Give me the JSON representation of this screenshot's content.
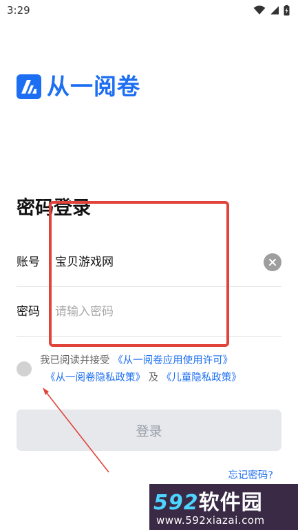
{
  "status_bar": {
    "time": "3:29"
  },
  "app": {
    "name": "从一阅卷"
  },
  "login": {
    "title": "密码登录",
    "account_label": "账号",
    "account_value": "宝贝游戏网",
    "password_label": "密码",
    "password_placeholder": "请输入密码"
  },
  "agreement": {
    "prefix": "我已阅读并接受",
    "license_link": "《从一阅卷应用使用许可》",
    "privacy_link": "《从一阅卷隐私政策》",
    "and": "及",
    "child_privacy_link": "《儿童隐私政策》"
  },
  "buttons": {
    "login": "登录",
    "forgot_password": "忘记密码?"
  },
  "watermark": {
    "brand_number": "592",
    "brand_text": "软件园",
    "url": "www.592xiazai.com"
  },
  "colors": {
    "accent": "#1c6ef2",
    "annotation": "#e0433a",
    "button_disabled": "#e6e8ec"
  },
  "icons": [
    "wifi-icon",
    "signal-icon",
    "battery-icon",
    "logo-icon",
    "clear-icon"
  ]
}
